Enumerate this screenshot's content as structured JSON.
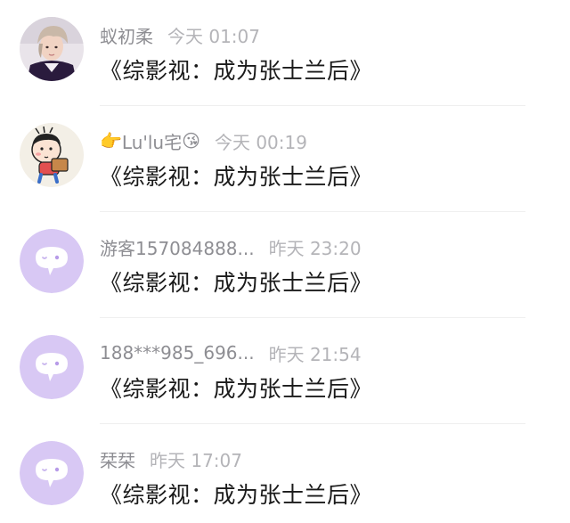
{
  "comments": [
    {
      "avatar": "photo-avatar",
      "username": "蚁初柔",
      "time": "今天 01:07",
      "message": "《综影视：成为张士兰后》"
    },
    {
      "avatar": "cartoon-avatar",
      "username_prefix_emoji": "👉",
      "username": "Lu'lu宅",
      "username_suffix_emoji": "😘",
      "time": "今天 00:19",
      "message": "《综影视：成为张士兰后》"
    },
    {
      "avatar": "default-chat-avatar",
      "username": "游客157084888...",
      "time": "昨天 23:20",
      "message": "《综影视：成为张士兰后》"
    },
    {
      "avatar": "default-chat-avatar",
      "username": "188***985_696...",
      "time": "昨天 21:54",
      "message": "《综影视：成为张士兰后》"
    },
    {
      "avatar": "default-chat-avatar",
      "username": "栞栞",
      "time": "昨天 17:07",
      "message": "《综影视：成为张士兰后》"
    }
  ],
  "colors": {
    "username": "#8e8e93",
    "time": "#b4b4b8",
    "message": "#1a1a1a",
    "default_avatar_bg": "#d8c8f4",
    "default_avatar_icon": "#ffffff"
  }
}
